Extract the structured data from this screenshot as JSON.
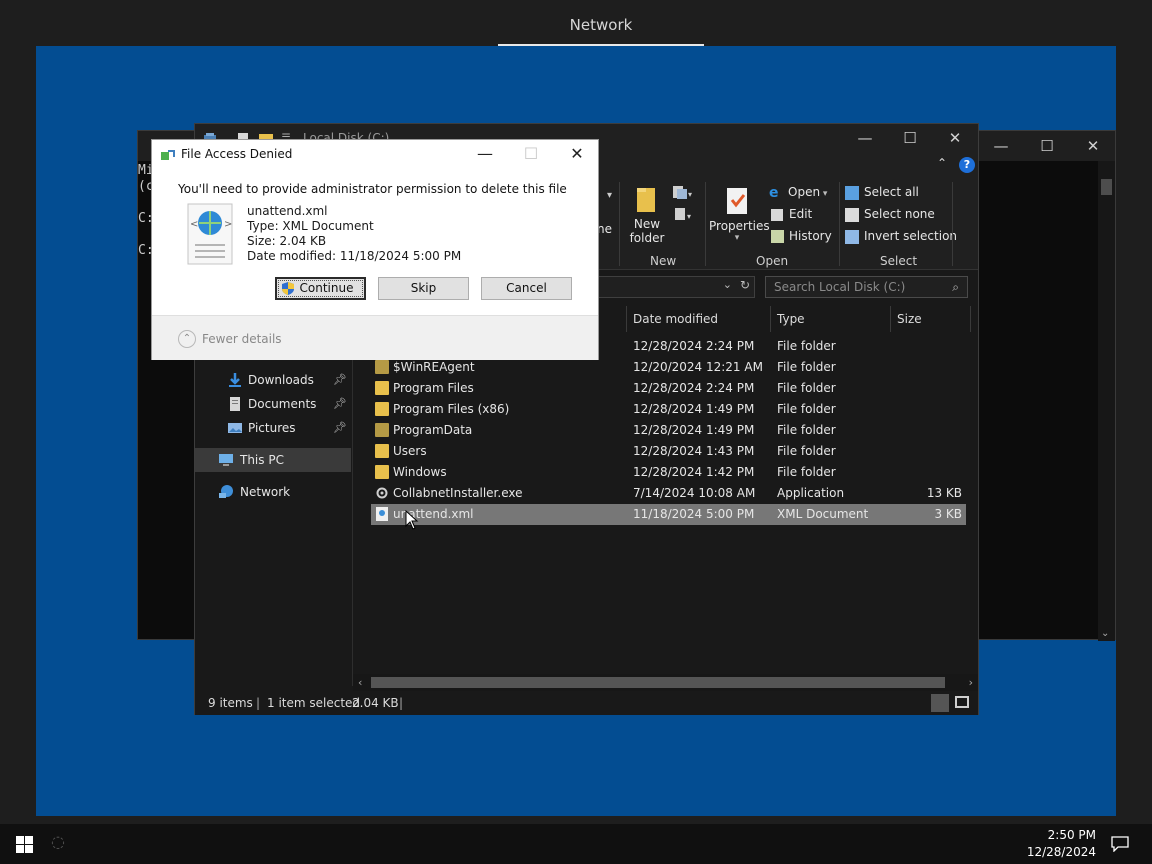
{
  "top_tab": {
    "label": "Network"
  },
  "console": {
    "lines": [
      "Mi",
      "(c",
      "",
      "C:",
      "",
      "C:"
    ],
    "controls": {
      "minimize": "—",
      "maximize": "☐",
      "close": "✕"
    }
  },
  "explorer": {
    "title": "Local Disk (C:)",
    "controls": {
      "minimize": "—",
      "maximize": "☐",
      "close": "✕"
    },
    "ribbon": {
      "partial_label": "ne",
      "new_group": {
        "label": "New",
        "new_folder_line1": "New",
        "new_folder_line2": "folder"
      },
      "open_group": {
        "label": "Open",
        "properties": "Properties",
        "open": "Open",
        "edit": "Edit",
        "history": "History"
      },
      "select_group": {
        "label": "Select",
        "select_all": "Select all",
        "select_none": "Select none",
        "invert_selection": "Invert selection"
      }
    },
    "search_placeholder": "Search Local Disk (C:)",
    "nav": {
      "downloads": "Downloads",
      "documents": "Documents",
      "pictures": "Pictures",
      "this_pc": "This PC",
      "network": "Network"
    },
    "columns": {
      "date": "Date modified",
      "type": "Type",
      "size": "Size"
    },
    "files": [
      {
        "name": "",
        "date": "12/28/2024 2:24 PM",
        "type": "File folder",
        "size": ""
      },
      {
        "name": "$WinREAgent",
        "date": "12/20/2024 12:21 AM",
        "type": "File folder",
        "size": ""
      },
      {
        "name": "Program Files",
        "date": "12/28/2024 2:24 PM",
        "type": "File folder",
        "size": ""
      },
      {
        "name": "Program Files (x86)",
        "date": "12/28/2024 1:49 PM",
        "type": "File folder",
        "size": ""
      },
      {
        "name": "ProgramData",
        "date": "12/28/2024 1:49 PM",
        "type": "File folder",
        "size": ""
      },
      {
        "name": "Users",
        "date": "12/28/2024 1:43 PM",
        "type": "File folder",
        "size": ""
      },
      {
        "name": "Windows",
        "date": "12/28/2024 1:42 PM",
        "type": "File folder",
        "size": ""
      },
      {
        "name": "CollabnetInstaller.exe",
        "date": "7/14/2024 10:08 AM",
        "type": "Application",
        "size": "13 KB"
      },
      {
        "name": "unattend.xml",
        "date": "11/18/2024 5:00 PM",
        "type": "XML Document",
        "size": "3 KB"
      }
    ],
    "status": {
      "items": "9 items",
      "selected": "1 item selected",
      "selected_size": "2.04 KB"
    }
  },
  "dialog": {
    "title": "File Access Denied",
    "message": "You'll need to provide administrator permission to delete this file",
    "file_name": "unattend.xml",
    "file_type": "Type: XML Document",
    "file_size": "Size: 2.04 KB",
    "file_date": "Date modified: 11/18/2024 5:00 PM",
    "buttons": {
      "continue": "Continue",
      "skip": "Skip",
      "cancel": "Cancel"
    },
    "fewer_details": "Fewer details"
  },
  "taskbar": {
    "time": "2:50 PM",
    "date": "12/28/2024"
  },
  "colors": {
    "desktop": "#034d92",
    "selected_row": "#777777",
    "folder": "#e8c04c"
  }
}
